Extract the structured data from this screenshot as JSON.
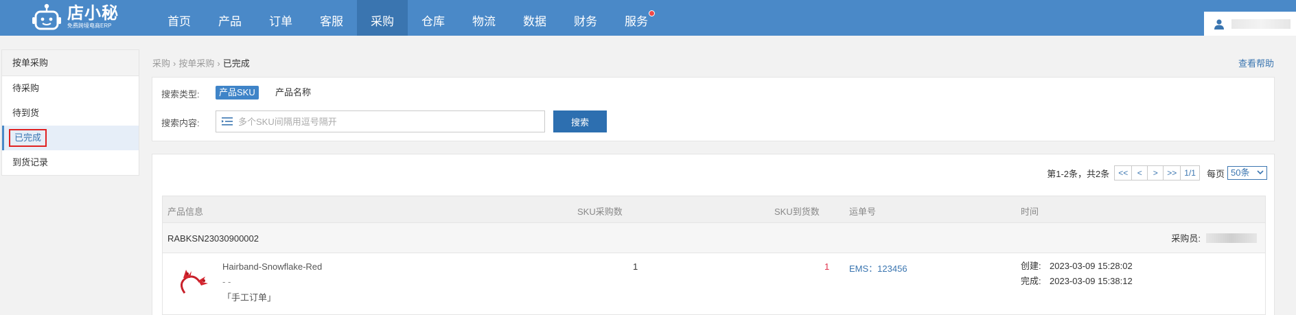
{
  "app": {
    "logo_title": "店小秘",
    "logo_sub": "免费跨境电商ERP"
  },
  "nav": [
    {
      "label": "首页",
      "active": false
    },
    {
      "label": "产品",
      "active": false
    },
    {
      "label": "订单",
      "active": false
    },
    {
      "label": "客服",
      "active": false
    },
    {
      "label": "采购",
      "active": true
    },
    {
      "label": "仓库",
      "active": false
    },
    {
      "label": "物流",
      "active": false
    },
    {
      "label": "数据",
      "active": false
    },
    {
      "label": "财务",
      "active": false
    },
    {
      "label": "服务",
      "active": false,
      "has_dot": true
    }
  ],
  "sidebar": {
    "title": "按单采购",
    "items": [
      {
        "label": "待采购"
      },
      {
        "label": "待到货"
      },
      {
        "label": "已完成"
      },
      {
        "label": "到货记录"
      }
    ]
  },
  "breadcrumb": [
    "采购",
    "按单采购",
    "已完成"
  ],
  "help_label": "查看帮助",
  "search": {
    "type_label": "搜索类型:",
    "type_options": [
      "产品SKU",
      "产品名称"
    ],
    "content_label": "搜索内容:",
    "placeholder": "多个SKU间隔用逗号隔开",
    "button": "搜索"
  },
  "pager": {
    "info": "第1-2条，共2条",
    "first": "<<",
    "prev": "<",
    "next": ">",
    "last": ">>",
    "page": "1/1",
    "per_label": "每页",
    "per_value": "50条"
  },
  "table": {
    "headers": [
      "产品信息",
      "SKU采购数",
      "SKU到货数",
      "运单号",
      "时间"
    ],
    "orders": [
      {
        "order_no": "RABKSN23030900002",
        "buyer_label": "采购员:",
        "items": [
          {
            "name": "Hairband-Snowflake-Red",
            "sub": "- -",
            "tag": "「手工订单」",
            "purchase_qty": "1",
            "arrived_qty": "1",
            "tracking": "EMS：123456",
            "created_label": "创建:",
            "created": "2023-03-09 15:28:02",
            "done_label": "完成:",
            "done": "2023-03-09 15:38:12"
          }
        ]
      }
    ]
  },
  "colors": {
    "topbar": "#4a89c8",
    "nav_active": "#3a75b0",
    "primary_button": "#2d6fb0",
    "link": "#3a75b0",
    "highlight_border": "#e02020",
    "arrived_qty": "#e0304a"
  },
  "icons": {
    "logo": "robot-icon",
    "user": "user-icon",
    "search_input": "list-icon",
    "select_caret": "chevron-down-icon"
  }
}
